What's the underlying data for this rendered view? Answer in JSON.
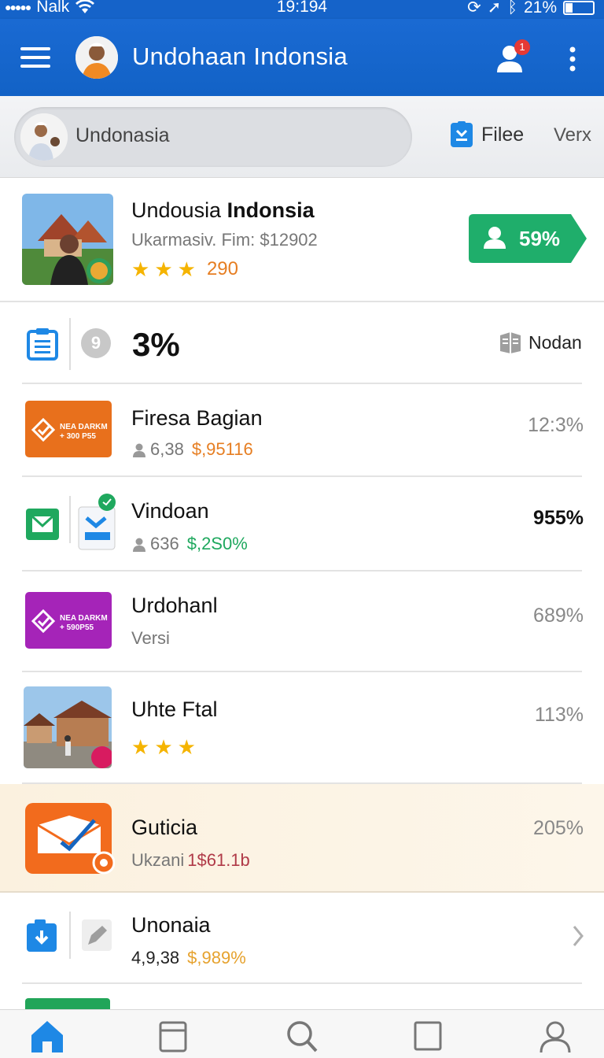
{
  "status_bar": {
    "carrier": "Nalk",
    "time": "19:194",
    "battery": "21%"
  },
  "app_bar": {
    "title": "Undohaan Indonsia",
    "notification_count": "1"
  },
  "search": {
    "text": "Undonasia",
    "file_label": "Filee",
    "extra_label": "Verx"
  },
  "featured": {
    "title_regular": "Undousia ",
    "title_bold": "Indonsia",
    "subtitle": "Ukarmasiv. Fim: $12902",
    "stars": 3,
    "rating_count": "290",
    "percent": "59%",
    "accent": "#1fae6b"
  },
  "summary": {
    "badge": "9",
    "percent": "3%",
    "label": "Nodan"
  },
  "rows": [
    {
      "title": "Firesa Bagian",
      "sub_count": "6,38",
      "sub_price": "$,95116",
      "price_color": "#e67e22",
      "percent": "12:3%",
      "thumb_color": "#e8701c",
      "thumb_lines": [
        "NEA DARKM",
        "+ 300 P55"
      ]
    },
    {
      "title": "Vindoan",
      "sub_count": "636",
      "sub_price": "$,2S0%",
      "price_color": "#1fa85e",
      "percent": "955%"
    },
    {
      "title": "Urdohanl",
      "sub_text": "Versi",
      "percent": "689%",
      "thumb_color": "#a524b8",
      "thumb_lines": [
        "NEA DARKM",
        "+ 590P55"
      ]
    },
    {
      "title": "Uhte Ftal",
      "stars": 3,
      "percent": "113%"
    },
    {
      "title": "Guticia",
      "sub_prefix": "Ukzani ",
      "sub_price": "1$61.1b",
      "price_color": "#b03a48",
      "percent": "205%"
    },
    {
      "title": "Unonaia",
      "sub_count": "4,9,38",
      "sub_price": "$,989%",
      "price_color": "#e6a22e"
    }
  ],
  "nav": [
    "home-icon",
    "tabs-icon",
    "search-icon",
    "square-icon",
    "profile-icon"
  ]
}
